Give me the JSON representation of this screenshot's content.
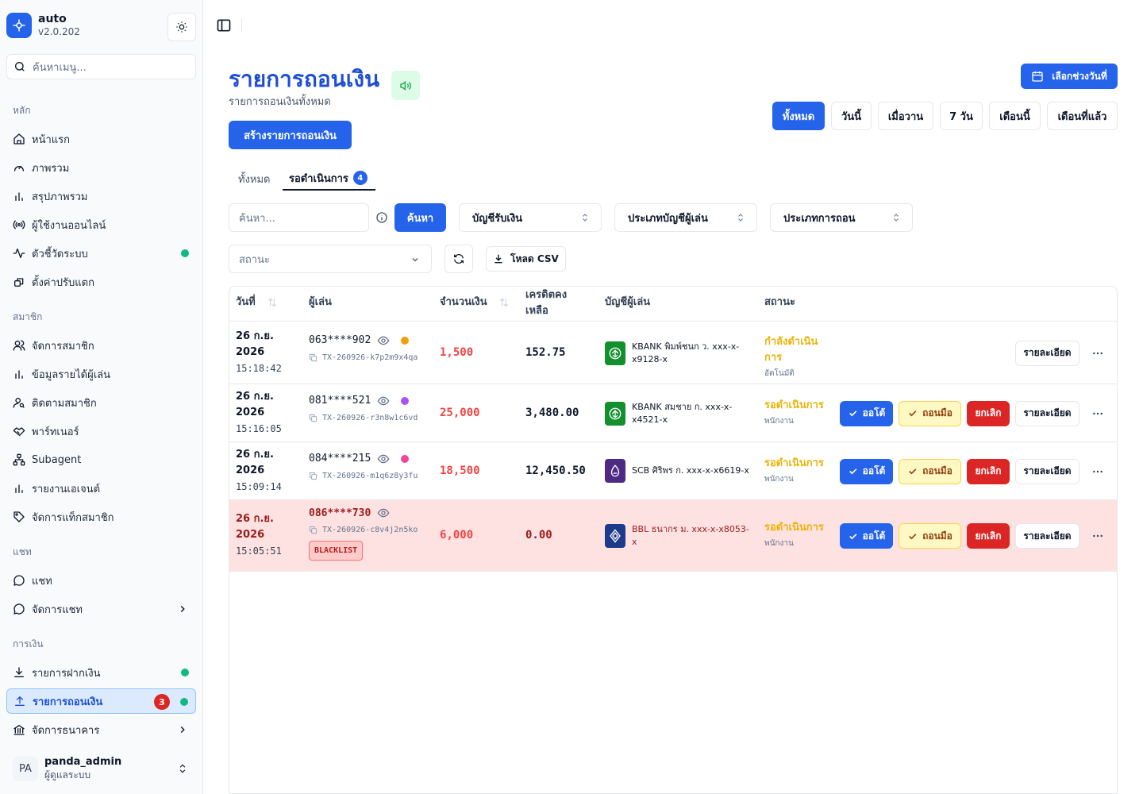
{
  "app": {
    "name": "auto",
    "version": "v2.0.202"
  },
  "sidebar": {
    "search_placeholder": "ค้นหาเมนู...",
    "groups": [
      {
        "label": "หลัก",
        "items": [
          {
            "label": "หน้าแรก",
            "icon": "home-icon"
          },
          {
            "label": "ภาพรวม",
            "icon": "gauge-icon"
          },
          {
            "label": "สรุปภาพรวม",
            "icon": "bar-chart-icon"
          },
          {
            "label": "ผู้ใช้งานออนไลน์",
            "icon": "radio-icon"
          },
          {
            "label": "ตัวชี้วัดระบบ",
            "icon": "activity-icon",
            "dot": true
          },
          {
            "label": "ตั้งค่าปรับแตก",
            "icon": "settings-icon"
          }
        ]
      },
      {
        "label": "สมาชิก",
        "items": [
          {
            "label": "จัดการสมาชิก",
            "icon": "users-icon"
          },
          {
            "label": "ข้อมูลรายได้ผู้เล่น",
            "icon": "bar-chart-icon"
          },
          {
            "label": "ติดตามสมาชิก",
            "icon": "user-search-icon"
          },
          {
            "label": "พาร์ทเนอร์",
            "icon": "handshake-icon"
          },
          {
            "label": "Subagent",
            "icon": "network-icon"
          },
          {
            "label": "รายงานเอเจนต์",
            "icon": "bar-chart-icon"
          },
          {
            "label": "จัดการแท็กสมาชิก",
            "icon": "tag-icon"
          }
        ]
      },
      {
        "label": "แชท",
        "items": [
          {
            "label": "แชท",
            "icon": "chat-icon"
          },
          {
            "label": "จัดการแชท",
            "icon": "chat-icon",
            "chevron": true
          }
        ]
      },
      {
        "label": "การเงิน",
        "items": [
          {
            "label": "รายการฝากเงิน",
            "icon": "download-icon",
            "dot": true
          },
          {
            "label": "รายการถอนเงิน",
            "icon": "upload-icon",
            "dot": true,
            "count": "3",
            "active": true
          },
          {
            "label": "จัดการธนาคาร",
            "icon": "bank-icon",
            "chevron": true
          }
        ]
      }
    ]
  },
  "user": {
    "initials": "PA",
    "name": "panda_admin",
    "role": "ผู้ดูแลระบบ"
  },
  "page": {
    "title": "รายการถอนเงิน",
    "subtitle": "รายการถอนเงินทั้งหมด",
    "create_label": "สร้างรายการถอนเงิน",
    "date_picker_label": "เลือกช่วงวันที่",
    "ranges": [
      "ทั้งหมด",
      "วันนี้",
      "เมื่อวาน",
      "7 วัน",
      "เดือนนี้",
      "เดือนที่แล้ว"
    ],
    "tabs": [
      {
        "label": "ทั้งหมด"
      },
      {
        "label": "รอดำเนินการ",
        "badge": "4"
      }
    ]
  },
  "filters": {
    "search_placeholder": "ค้นหา...",
    "search_button": "ค้นหา",
    "account_select": "บัญชีรับเงิน",
    "player_type_select": "ประเภทบัญชีผู้เล่น",
    "withdraw_type_select": "ประเภทการถอน",
    "status_placeholder": "สถานะ",
    "csv_label": "โหลด CSV"
  },
  "table": {
    "headers": {
      "date": "วันที่",
      "player": "ผู้เล่น",
      "amount": "จำนวนเงิน",
      "balance": "เครดิตคงเหลือ",
      "account": "บัญชีผู้เล่น",
      "status": "สถานะ"
    },
    "actions": {
      "auto": "ออโต้",
      "manual": "ถอนมือ",
      "cancel": "ยกเลิก",
      "detail": "รายละเอียด"
    },
    "rows": [
      {
        "date": "26 ก.ย. 2026",
        "time": "15:18:42",
        "phone": "063****902",
        "level_color": "#f59e0b",
        "tx": "TX-260926-k7p2m9x4qa",
        "amount": "1,500",
        "balance": "152.75",
        "bank": "kbank",
        "account": "KBANK พิมพ์ชนก ว. xxx-x-x9128-x",
        "status": "กำลังดำเนินการ",
        "mode": "อัตโนมัติ",
        "blacklist": false,
        "show_actions": false
      },
      {
        "date": "26 ก.ย. 2026",
        "time": "15:16:05",
        "phone": "081****521",
        "level_color": "#a855f7",
        "tx": "TX-260926-r3n8w1c6vd",
        "amount": "25,000",
        "balance": "3,480.00",
        "bank": "kbank",
        "account": "KBANK สมชาย ก. xxx-x-x4521-x",
        "status": "รอดำเนินการ",
        "mode": "พนักงาน",
        "blacklist": false,
        "show_actions": true
      },
      {
        "date": "26 ก.ย. 2026",
        "time": "15:09:14",
        "phone": "084****215",
        "level_color": "#ec4899",
        "tx": "TX-260926-m1q6z8y3fu",
        "amount": "18,500",
        "balance": "12,450.50",
        "bank": "scb",
        "account": "SCB ศิริพร ก. xxx-x-x6619-x",
        "status": "รอดำเนินการ",
        "mode": "พนักงาน",
        "blacklist": false,
        "show_actions": true
      },
      {
        "date": "26 ก.ย. 2026",
        "time": "15:05:51",
        "phone": "086****730",
        "level_color": "",
        "tx": "TX-260926-c8v4j2n5ko",
        "amount": "6,000",
        "balance": "0.00",
        "bank": "bbl",
        "account": "BBL ธนากร ม. xxx-x-x8053-x",
        "status": "รอดำเนินการ",
        "mode": "พนักงาน",
        "blacklist": true,
        "blacklist_label": "BLACKLIST",
        "show_actions": true
      }
    ]
  },
  "colors": {
    "primary": "#2563eb",
    "danger": "#dc2626",
    "warning": "#eab308",
    "success": "#10b981",
    "blacklist_row": "#fee2e2"
  }
}
